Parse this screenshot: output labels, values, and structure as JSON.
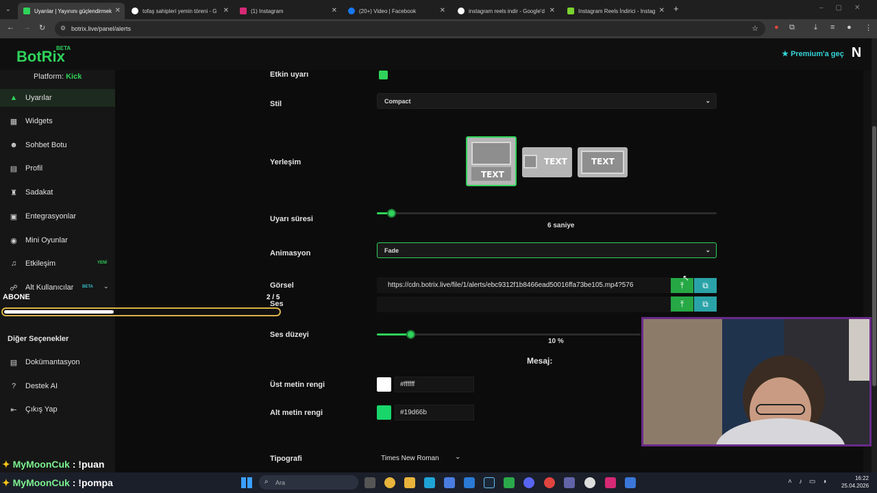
{
  "browser": {
    "tabs": [
      {
        "title": "Uyarılar | Yayınını güçlendirmek",
        "active": true
      },
      {
        "title": "tofaş sahipleri yemin töreni - G"
      },
      {
        "title": "(1) Instagram"
      },
      {
        "title": "(20+) Video | Facebook"
      },
      {
        "title": "instagram reels indir - Google'd"
      },
      {
        "title": "Instagram Reels İndirici - Instag"
      }
    ],
    "new_tab": "+",
    "url": "botrix.live/panel/alerts"
  },
  "header": {
    "logo": "BotRix",
    "beta": "BETA",
    "premium": "Premium'a geç",
    "avatar": "N"
  },
  "sidebar": {
    "platform_label": "Platform:",
    "platform_value": "Kick",
    "items": [
      {
        "label": "Uyarılar",
        "icon": "warning-icon"
      },
      {
        "label": "Widgets",
        "icon": "grid-icon"
      },
      {
        "label": "Sohbet Botu",
        "icon": "robot-icon"
      },
      {
        "label": "Profil",
        "icon": "profile-icon"
      },
      {
        "label": "Sadakat",
        "icon": "trophy-icon"
      },
      {
        "label": "Entegrasyonlar",
        "icon": "integration-icon"
      },
      {
        "label": "Mini Oyunlar",
        "icon": "gamepad-icon"
      },
      {
        "label": "Etkileşim",
        "icon": "music-icon",
        "badge": "YENİ"
      },
      {
        "label": "Alt Kullanıcılar",
        "icon": "users-icon",
        "badge": "BETA"
      }
    ],
    "other_title": "Diğer Seçenekler",
    "other_items": [
      {
        "label": "Dokümantasyon",
        "icon": "doc-icon"
      },
      {
        "label": "Destek AI",
        "icon": "help-icon"
      },
      {
        "label": "Çıkış Yap",
        "icon": "logout-icon"
      }
    ]
  },
  "form": {
    "enabled_label": "Etkin uyarı",
    "style_label": "Stil",
    "style_value": "Compact",
    "layout_label": "Yerleşim",
    "layout_text": "TEXT",
    "duration_label": "Uyarı süresi",
    "duration_value": "6",
    "duration_unit": "saniye",
    "duration_fraction": 0.042,
    "animation_label": "Animasyon",
    "animation_value": "Fade",
    "image_label": "Görsel",
    "image_url": "https://cdn.botrix.live/file/1/alerts/ebc9312f1b8466ead50016ffa73be105.mp4?576",
    "sound_label": "Ses",
    "volume_label": "Ses düzeyi",
    "volume_value": "10",
    "volume_unit": "%",
    "volume_fraction": 0.1,
    "message_label": "Mesaj:",
    "top_color_label": "Üst metin rengi",
    "top_color": "#ffffff",
    "bottom_color_label": "Alt metin rengi",
    "bottom_color": "#19d66b",
    "typography_label": "Tipografi",
    "typography_value": "Times New Roman"
  },
  "overlay": {
    "goal_title": "ABONE",
    "goal_progress": "2 / 5",
    "goal_fraction": 0.4,
    "chat": [
      {
        "user": "MyMoonCuk",
        "text": ": !puan"
      },
      {
        "user": "MyMoonCuk",
        "text": ": !pompa"
      }
    ]
  },
  "taskbar": {
    "search_placeholder": "Ara",
    "time": "16:22",
    "date": "25.04.2026"
  },
  "colors": {
    "accent": "#2fd35a",
    "premium": "#35d4d8",
    "upload": "#26a845",
    "browse": "#2aa3a8"
  }
}
